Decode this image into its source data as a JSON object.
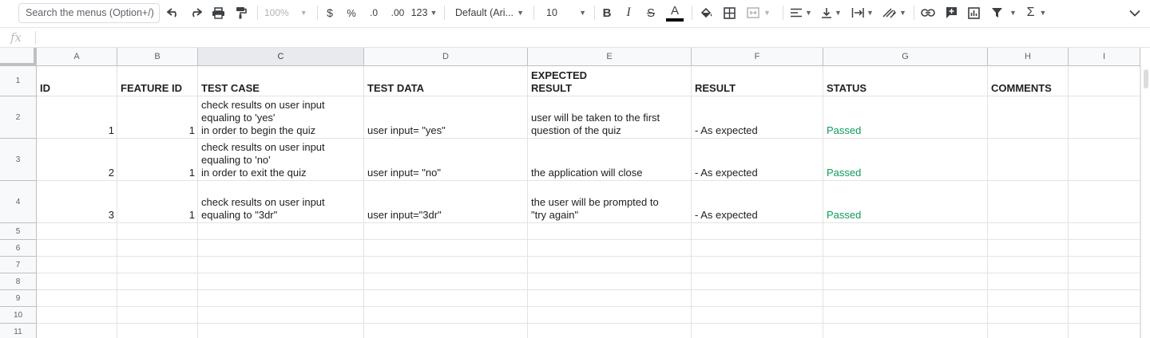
{
  "toolbar": {
    "search_placeholder": "Search the menus (Option+/)",
    "zoom": "100%",
    "currency": "$",
    "percent": "%",
    "decimal_decrease": ".0",
    "decimal_increase": ".00",
    "more_formats": "123",
    "font": "Default (Ari...",
    "font_size": "10",
    "bold": "B",
    "italic": "I",
    "strikethrough": "S",
    "text_color": "A",
    "sum": "Σ"
  },
  "formula_bar": {
    "fx": "fx",
    "value": ""
  },
  "columns": [
    "A",
    "B",
    "C",
    "D",
    "E",
    "F",
    "G",
    "H",
    "I"
  ],
  "rows": [
    "1",
    "2",
    "3",
    "4",
    "5",
    "6",
    "7",
    "8",
    "9",
    "10",
    "11"
  ],
  "sheet": {
    "headers": [
      "ID",
      "FEATURE ID",
      "TEST CASE",
      "TEST DATA",
      "EXPECTED\nRESULT",
      "RESULT",
      "STATUS",
      "COMMENTS"
    ],
    "data": [
      [
        "1",
        "1",
        "check results on user input\nequaling to 'yes'\nin order to begin the quiz",
        "user input= \"yes\"",
        "user will be taken to the first\nquestion of the quiz",
        "- As expected",
        "Passed",
        ""
      ],
      [
        "2",
        "1",
        "check results on user input\nequaling to 'no'\nin order to exit the quiz",
        "user input= \"no\"",
        "the application will close",
        "- As expected",
        "Passed",
        ""
      ],
      [
        "3",
        "1",
        "check results on user input\nequaling to \"3dr\"",
        "user input=\"3dr\"",
        "the user will be prompted to\n\"try again\"",
        "- As expected",
        "Passed",
        ""
      ]
    ]
  },
  "colors": {
    "passed": "#0f9d58",
    "header_bg": "#f8f9fa",
    "selected_header_bg": "#e8eaed",
    "gridline": "#e2e3e3"
  }
}
